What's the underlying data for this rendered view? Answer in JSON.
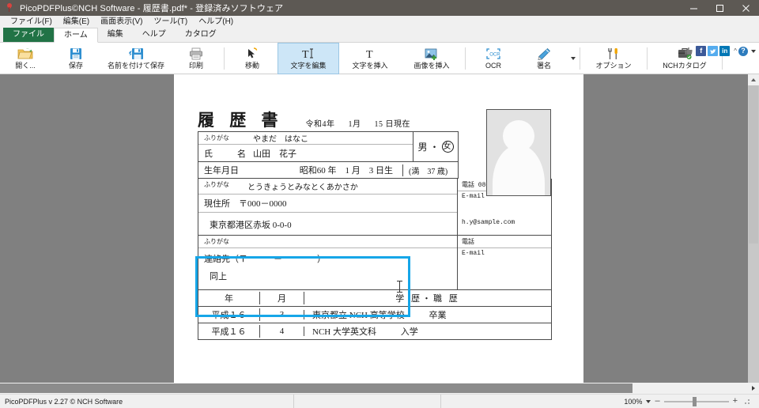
{
  "window": {
    "title": "PicoPDFPlus©NCH Software - 履歴書.pdf* - 登録済みソフトウェア",
    "app_icon": "pin-icon",
    "minimize": "–",
    "maximize": "□",
    "close": "✕"
  },
  "menubar": {
    "items": [
      {
        "label": "ファイル(F)"
      },
      {
        "label": "編集(E)"
      },
      {
        "label": "画面表示(V)"
      },
      {
        "label": "ツール(T)"
      },
      {
        "label": "ヘルプ(H)"
      }
    ]
  },
  "tabs": [
    {
      "label": "ファイル",
      "state": "file"
    },
    {
      "label": "ホーム",
      "state": "active"
    },
    {
      "label": "編集",
      "state": "normal"
    },
    {
      "label": "ヘルプ",
      "state": "normal"
    },
    {
      "label": "カタログ",
      "state": "normal"
    }
  ],
  "toolbar": {
    "items": [
      {
        "label": "開く...",
        "icon": "open-folder-icon"
      },
      {
        "label": "保存",
        "icon": "save-floppy-icon"
      },
      {
        "label": "名前を付けて保存",
        "icon": "save-as-floppy-icon"
      },
      {
        "label": "印刷",
        "icon": "printer-icon"
      },
      {
        "label": "移動",
        "icon": "move-cursor-icon"
      },
      {
        "label": "文字を編集",
        "icon": "edit-text-icon"
      },
      {
        "label": "文字を挿入",
        "icon": "insert-text-icon"
      },
      {
        "label": "画像を挿入",
        "icon": "insert-image-icon"
      },
      {
        "label": "OCR",
        "icon": "ocr-icon"
      },
      {
        "label": "署名",
        "icon": "signature-pen-icon"
      },
      {
        "label": "オプション",
        "icon": "options-tools-icon"
      },
      {
        "label": "NCHカタログ",
        "icon": "nch-catalog-icon"
      }
    ],
    "social": [
      {
        "name": "thumbs-up-icon",
        "glyph": "👍"
      },
      {
        "name": "facebook-icon",
        "glyph": "f"
      },
      {
        "name": "twitter-icon",
        "glyph": "t"
      },
      {
        "name": "linkedin-icon",
        "glyph": "in"
      }
    ],
    "help_chevron": "^",
    "help_badge": "?"
  },
  "document": {
    "title": "履 歴 書",
    "date": {
      "era_year": "令和4年",
      "month": "1月",
      "day": "15 日現在"
    },
    "photo_placeholder": "person-silhouette-icon",
    "name_section": {
      "furigana_label": "ふりがな",
      "furigana_value": "やまだ　はなこ",
      "name_label": "氏　　名",
      "name_value": "山田　花子",
      "gender_label": "男 ・ 女",
      "gender_male": "男",
      "gender_sep": "・",
      "gender_female": "女"
    },
    "birth_row": {
      "label": "生年月日",
      "value": "昭和60 年　1 月　3 日生",
      "age": "(満　37 歳)"
    },
    "address_section": {
      "furigana_label": "ふりがな",
      "furigana_value": "とうきょうとみなとくあかさか",
      "address_label": "現住所　〒000－0000",
      "address_value": "東京都港区赤坂 0-0-0",
      "phone_label": "電話 080-0000-0000",
      "email_label": "E-mail",
      "email_value": "h.y@sample.com"
    },
    "contact_section": {
      "furigana_label": "ふりがな",
      "contact_label": "連絡先（〒　　　－　　　　）",
      "contact_value": "同上",
      "phone_label": "電話",
      "email_label": "E-mail"
    },
    "history_table": {
      "headers": {
        "year": "年",
        "month": "月",
        "description": "学 歴・職 歴"
      },
      "rows": [
        {
          "year": "平成１６",
          "month": "3",
          "description": "東京都立 NCH 高等学校",
          "action": "卒業"
        },
        {
          "year": "平成１６",
          "month": "4",
          "description": "NCH 大学英文科",
          "action": "入学"
        }
      ]
    }
  },
  "selection": {
    "label": "edit-text-selection-box",
    "accent_color": "#16a6e8"
  },
  "statusbar": {
    "version_text": "PicoPDFPlus v 2.27 © NCH Software",
    "segment_two": "",
    "segment_three": "",
    "zoom_level": "100%",
    "zoom_out": "–",
    "zoom_in": "+"
  }
}
